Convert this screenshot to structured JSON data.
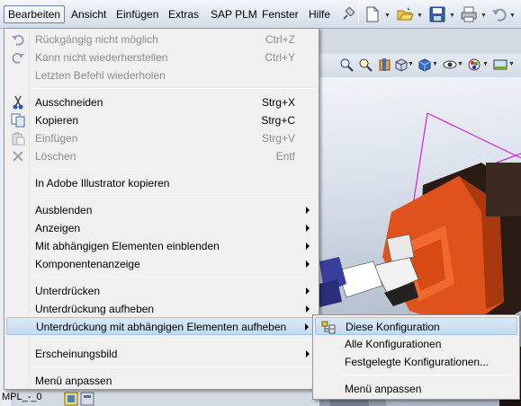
{
  "menubar": {
    "items": [
      "Bearbeiten",
      "Ansicht",
      "Einfügen",
      "Extras",
      "SAP PLM",
      "Fenster",
      "Hilfe"
    ],
    "active_index": 0
  },
  "toolbar_icons": [
    "pin-icon",
    "new-document-icon",
    "open-folder-icon",
    "save-icon",
    "print-icon",
    "undo-icon",
    "select-arrow-icon"
  ],
  "view_toolbar_icons": [
    "zoom-icon",
    "zoom-area-icon",
    "section-view-icon",
    "view-orientation-icon",
    "display-style-icon",
    "hide-show-icon",
    "appearance-icon",
    "scene-icon"
  ],
  "left_panel": {
    "tree_text": "MPL_-_0"
  },
  "edit_menu": {
    "items": [
      {
        "label": "Rückgängig nicht möglich",
        "shortcut": "Ctrl+Z",
        "enabled": false,
        "icon": "undo-icon"
      },
      {
        "label": "Kann nicht wiederherstellen",
        "shortcut": "Ctrl+Y",
        "enabled": false,
        "icon": "redo-icon"
      },
      {
        "label": "Letzten Befehl wiederholen",
        "shortcut": "",
        "enabled": false,
        "icon": ""
      },
      {
        "label": "Ausschneiden",
        "shortcut": "Strg+X",
        "enabled": true,
        "icon": "scissors-icon"
      },
      {
        "label": "Kopieren",
        "shortcut": "Strg+C",
        "enabled": true,
        "icon": "copy-icon"
      },
      {
        "label": "Einfügen",
        "shortcut": "Strg+V",
        "enabled": false,
        "icon": "paste-icon"
      },
      {
        "label": "Löschen",
        "shortcut": "Entf",
        "enabled": false,
        "icon": "delete-icon"
      },
      {
        "label": "In Adobe Illustrator kopieren",
        "shortcut": "",
        "enabled": true,
        "icon": ""
      },
      {
        "label": "Ausblenden",
        "shortcut": "",
        "enabled": true,
        "submenu": true
      },
      {
        "label": "Anzeigen",
        "shortcut": "",
        "enabled": true,
        "submenu": true
      },
      {
        "label": "Mit abhängigen Elementen einblenden",
        "shortcut": "",
        "enabled": true,
        "submenu": true
      },
      {
        "label": "Komponentenanzeige",
        "shortcut": "",
        "enabled": true,
        "submenu": true
      },
      {
        "label": "Unterdrücken",
        "shortcut": "",
        "enabled": true,
        "submenu": true
      },
      {
        "label": "Unterdrückung aufheben",
        "shortcut": "",
        "enabled": true,
        "submenu": true
      },
      {
        "label": "Unterdrückung mit abhängigen Elementen aufheben",
        "shortcut": "",
        "enabled": true,
        "submenu": true,
        "highlighted": true
      },
      {
        "label": "Erscheinungsbild",
        "shortcut": "",
        "enabled": true,
        "submenu": true
      },
      {
        "label": "Menü anpassen",
        "shortcut": "",
        "enabled": true
      }
    ]
  },
  "submenu": {
    "items": [
      {
        "label": "Diese Konfiguration",
        "highlighted": true,
        "icon": "configuration-icon"
      },
      {
        "label": "Alle Konfigurationen"
      },
      {
        "label": "Festgelegte Konfigurationen..."
      },
      {
        "label": "Menü anpassen"
      }
    ]
  },
  "colors": {
    "accent": "#c5d9f1",
    "model_orange": "#e0521c",
    "bounding_box": "#d81fd8"
  }
}
